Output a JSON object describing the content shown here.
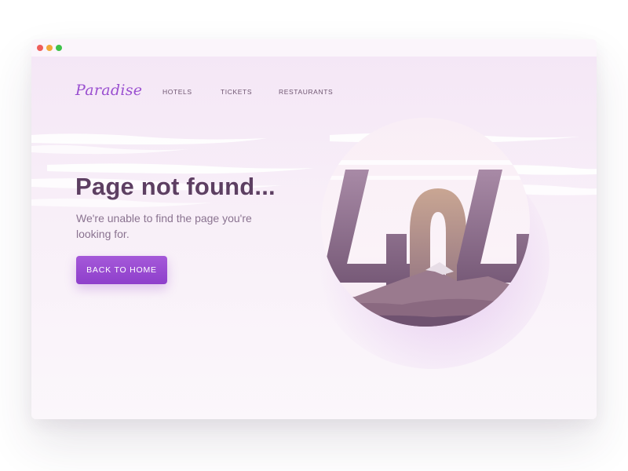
{
  "brand": {
    "logo_text": "Paradise",
    "accent_color": "#9a4fd0"
  },
  "nav": {
    "items": [
      {
        "label": "HOTELS"
      },
      {
        "label": "TICKETS"
      },
      {
        "label": "RESTAURANTS"
      }
    ]
  },
  "content": {
    "title": "Page not found...",
    "message": "We're unable to find the page you're looking for.",
    "button_label": "BACK TO HOME"
  },
  "illustration": {
    "error_code": "404",
    "icon": "404-mountain-lake-icon"
  }
}
